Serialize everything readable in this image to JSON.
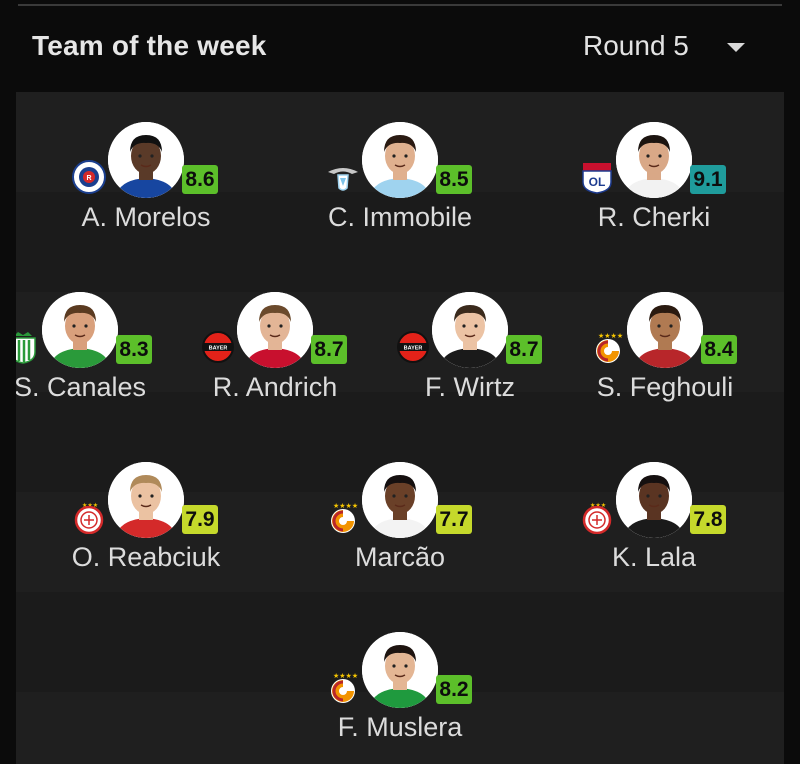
{
  "header": {
    "title": "Team of the week",
    "round": "Round 5",
    "dropdown_icon": "caret-down-icon"
  },
  "colors": {
    "rating_green": "#5cbf2a",
    "rating_lime": "#c5d92b",
    "rating_teal": "#1f9c9c",
    "background": "#1b1b1b"
  },
  "players": [
    {
      "name": "A. Morelos",
      "rating": "8.6",
      "rating_color": "#5cbf2a",
      "club_badge": "rangers-crest-icon",
      "skin": "#5a3a28",
      "hair": "#111111",
      "shirt": "#1746a0"
    },
    {
      "name": "C. Immobile",
      "rating": "8.5",
      "rating_color": "#5cbf2a",
      "club_badge": "lazio-eagle-icon",
      "skin": "#e0b08e",
      "hair": "#2a1a12",
      "shirt": "#9fd3ef"
    },
    {
      "name": "R. Cherki",
      "rating": "9.1",
      "rating_color": "#1f9c9c",
      "club_badge": "lyon-crest-icon",
      "skin": "#d9a887",
      "hair": "#1c1410",
      "shirt": "#f2f2f2"
    },
    {
      "name": "S. Canales",
      "rating": "8.3",
      "rating_color": "#5cbf2a",
      "club_badge": "betis-crest-icon",
      "skin": "#d9a07c",
      "hair": "#5a3a20",
      "shirt": "#2a9a3a"
    },
    {
      "name": "R. Andrich",
      "rating": "8.7",
      "rating_color": "#5cbf2a",
      "club_badge": "leverkusen-crest-icon",
      "skin": "#e3b596",
      "hair": "#6b4a2c",
      "shirt": "#c8102e"
    },
    {
      "name": "F. Wirtz",
      "rating": "8.7",
      "rating_color": "#5cbf2a",
      "club_badge": "leverkusen-crest-icon",
      "skin": "#ecc3a4",
      "hair": "#3a2a1c",
      "shirt": "#1a1a1a"
    },
    {
      "name": "S. Feghouli",
      "rating": "8.4",
      "rating_color": "#5cbf2a",
      "club_badge": "galatasaray-crest-icon",
      "skin": "#b07a52",
      "hair": "#2a1a10",
      "shirt": "#b8262a"
    },
    {
      "name": "O. Reabciuk",
      "rating": "7.9",
      "rating_color": "#c5d92b",
      "club_badge": "olympiacos-crest-icon",
      "skin": "#ebc2a2",
      "hair": "#b08a5a",
      "shirt": "#d42a2a"
    },
    {
      "name": "Marcão",
      "rating": "7.7",
      "rating_color": "#c5d92b",
      "club_badge": "galatasaray-crest-icon",
      "skin": "#6a4028",
      "hair": "#151010",
      "shirt": "#f3f3f3"
    },
    {
      "name": "K. Lala",
      "rating": "7.8",
      "rating_color": "#c5d92b",
      "club_badge": "olympiacos-crest-icon",
      "skin": "#5a3422",
      "hair": "#151010",
      "shirt": "#1a1a1a"
    },
    {
      "name": "F. Muslera",
      "rating": "8.2",
      "rating_color": "#5cbf2a",
      "club_badge": "galatasaray-crest-icon",
      "skin": "#e4b694",
      "hair": "#1e1410",
      "shirt": "#1f9a3e"
    }
  ]
}
